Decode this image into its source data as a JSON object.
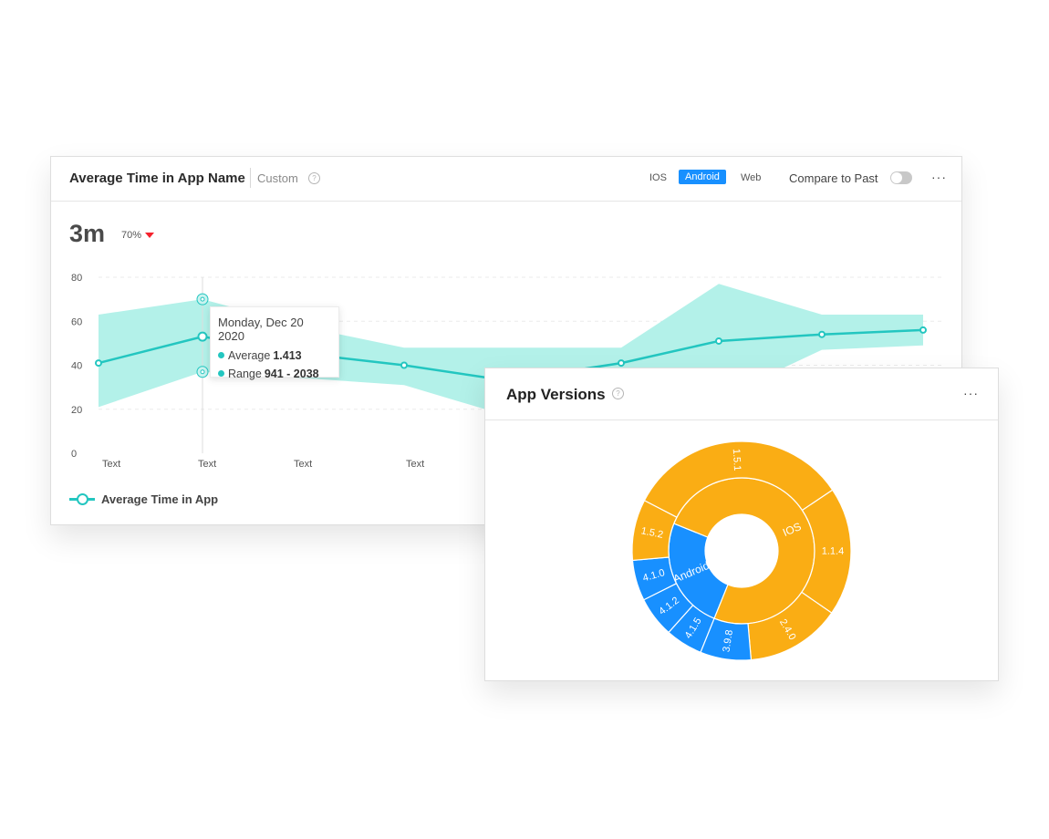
{
  "time_card": {
    "title": "Average Time in App Name",
    "range_label": "Custom",
    "help_icon": "question-circle-icon",
    "platforms": [
      "IOS",
      "Android",
      "Web"
    ],
    "selected_platform": "Android",
    "compare_label": "Compare to Past",
    "compare_enabled": false,
    "more_icon": "ellipsis-icon",
    "metric_value": "3m",
    "delta": "70%",
    "delta_direction": "down",
    "colors": {
      "line": "#23c6c0",
      "band": "#b3f1e9",
      "accent": "#1890ff",
      "down": "#f5222d"
    },
    "tooltip": {
      "date": "Monday, Dec 20 2020",
      "average_label": "Average",
      "average_value": "1.413",
      "range_label": "Range",
      "range_value": "941 - 2038"
    },
    "legend_label": "Average Time in App"
  },
  "chart_data": [
    {
      "type": "line",
      "ylim": [
        0,
        80
      ],
      "y_ticks": [
        0,
        20,
        40,
        60,
        80
      ],
      "x_tick_labels": [
        "Text",
        "Text",
        "Text",
        "Text"
      ],
      "grid": true,
      "legend_position": "bottom-left",
      "x": [
        1,
        2,
        3,
        4,
        5,
        6,
        7,
        8,
        9
      ],
      "series": [
        {
          "name": "Average Time in App",
          "values": [
            41,
            53,
            45,
            40,
            33,
            41,
            51,
            54,
            56
          ],
          "band_low": [
            21,
            37,
            34,
            31,
            17,
            22,
            25,
            47,
            49
          ],
          "band_high": [
            63,
            70,
            57,
            48,
            48,
            48,
            77,
            63,
            63
          ]
        }
      ]
    },
    {
      "type": "sunburst",
      "title": "App Versions",
      "inner": [
        {
          "label": "Android",
          "value": 25,
          "color": "#1890ff"
        },
        {
          "label": "IOS",
          "value": 75,
          "color": "#faad14"
        }
      ],
      "outer": [
        {
          "label": "4.1.5",
          "value": 5.5,
          "color": "#1890ff"
        },
        {
          "label": "4.1.2",
          "value": 6,
          "color": "#1890ff"
        },
        {
          "label": "4.1.0",
          "value": 6,
          "color": "#1890ff"
        },
        {
          "label": "1.5.2",
          "value": 9,
          "color": "#faad14"
        },
        {
          "label": "1.5.1",
          "value": 33,
          "color": "#faad14"
        },
        {
          "label": "1.1.4",
          "value": 19,
          "color": "#faad14"
        },
        {
          "label": "2.4.0",
          "value": 14,
          "color": "#faad14"
        },
        {
          "label": "3.9.8",
          "value": 7.5,
          "color": "#1890ff"
        }
      ]
    }
  ],
  "versions_card": {
    "title": "App Versions",
    "help_icon": "question-circle-icon",
    "more_icon": "ellipsis-icon"
  }
}
